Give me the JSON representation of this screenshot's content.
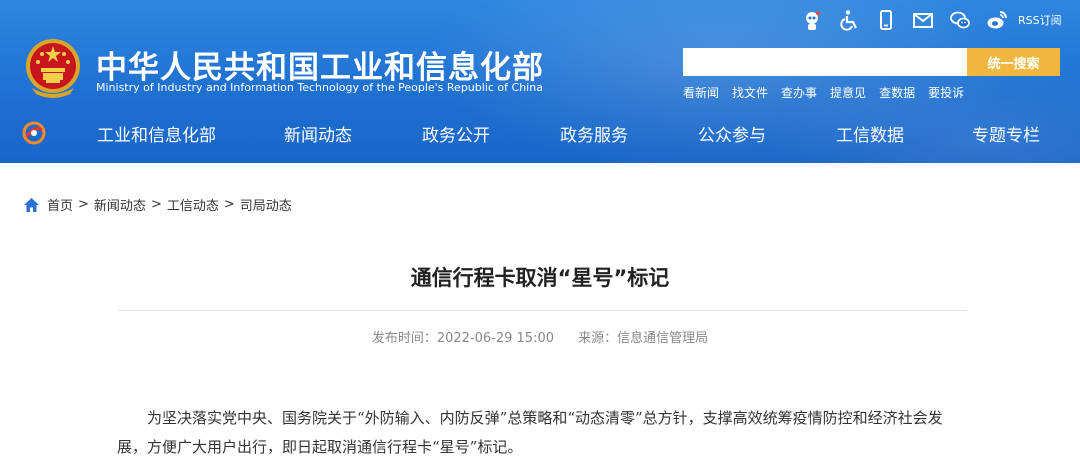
{
  "header": {
    "title_cn": "中华人民共和国工业和信息化部",
    "title_en": "Ministry of Industry and Information Technology of the People's Republic of China",
    "top_icons": [
      "robot-icon",
      "accessibility-icon",
      "mobile-icon",
      "mail-icon",
      "wechat-icon",
      "weibo-icon"
    ],
    "rss_label": "RSS订阅",
    "search": {
      "placeholder": "",
      "value": "",
      "button_label": "统一搜索"
    },
    "quick_links": [
      "看新闻",
      "找文件",
      "查办事",
      "提意见",
      "查数据",
      "要投诉"
    ],
    "colors": {
      "header_bg": "#1e6fd0",
      "search_button": "#f0b63f"
    }
  },
  "nav": {
    "items": [
      "工业和信息化部",
      "新闻动态",
      "政务公开",
      "政务服务",
      "公众参与",
      "工信数据",
      "专题专栏"
    ]
  },
  "breadcrumb": {
    "items": [
      "首页",
      "新闻动态",
      "工信动态",
      "司局动态"
    ],
    "separator": ">"
  },
  "article": {
    "title": "通信行程卡取消“星号”标记",
    "publish_label": "发布时间：2022-06-29 15:00",
    "source_label": "来源：信息通信管理局",
    "paragraph": "为坚决落实党中央、国务院关于“外防输入、内防反弹”总策略和“动态清零”总方针，支撑高效统筹疫情防控和经济社会发展，方便广大用户出行，即日起取消通信行程卡“星号”标记。"
  }
}
